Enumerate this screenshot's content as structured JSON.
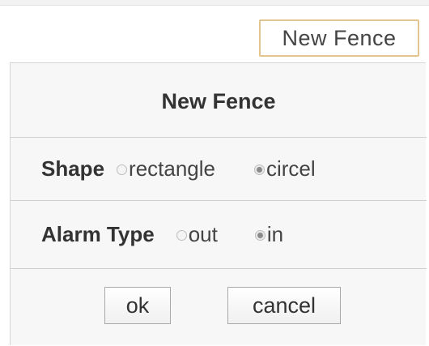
{
  "tab": {
    "label": "New Fence"
  },
  "dialog": {
    "title": "New Fence",
    "shape": {
      "label": "Shape",
      "options": [
        {
          "label": "rectangle",
          "checked": false
        },
        {
          "label": "circel",
          "checked": true
        }
      ]
    },
    "alarm_type": {
      "label": "Alarm Type",
      "options": [
        {
          "label": "out",
          "checked": false
        },
        {
          "label": "in",
          "checked": true
        }
      ]
    },
    "buttons": {
      "ok": "ok",
      "cancel": "cancel"
    }
  },
  "colors": {
    "tab_border": "#e3c590",
    "panel_bg": "#f7f7f7",
    "divider": "#d0d0d0"
  }
}
